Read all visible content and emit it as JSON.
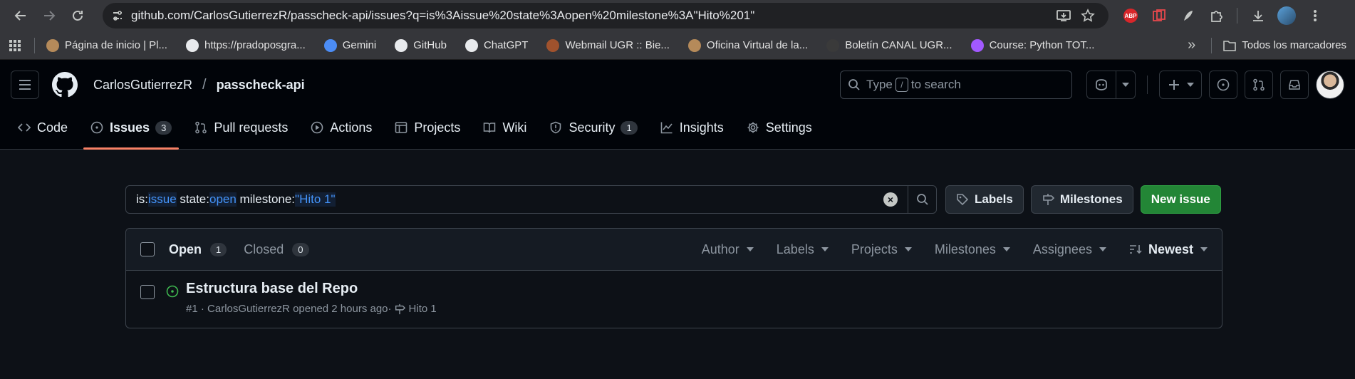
{
  "browser": {
    "url": "github.com/CarlosGutierrezR/passcheck-api/issues?q=is%3Aissue%20state%3Aopen%20milestone%3A\"Hito%201\"",
    "abp_label": "ABP"
  },
  "bookmarks": {
    "items": [
      {
        "label": "Página de inicio | Pl...",
        "color": "#b58a5a"
      },
      {
        "label": "https://pradoposgra...",
        "color": "#e8eaed"
      },
      {
        "label": "Gemini",
        "color": "#4c8df6"
      },
      {
        "label": "GitHub",
        "color": "#e8eaed"
      },
      {
        "label": "ChatGPT",
        "color": "#e8eaed"
      },
      {
        "label": "Webmail UGR :: Bie...",
        "color": "#a0522d"
      },
      {
        "label": "Oficina Virtual de la...",
        "color": "#b58a5a"
      },
      {
        "label": "Boletín CANAL UGR...",
        "color": "#3a3a3a"
      },
      {
        "label": "Course: Python TOT...",
        "color": "#a259ff"
      }
    ],
    "more": "»",
    "all_bookmarks": "Todos los marcadores"
  },
  "repo": {
    "owner": "CarlosGutierrezR",
    "separator": "/",
    "name": "passcheck-api"
  },
  "header": {
    "search_prefix": "Type",
    "search_key": "/",
    "search_suffix": "to search"
  },
  "tabs": [
    {
      "label": "Code",
      "icon": "code-icon"
    },
    {
      "label": "Issues",
      "icon": "issue-opened-icon",
      "count": "3"
    },
    {
      "label": "Pull requests",
      "icon": "git-pull-request-icon"
    },
    {
      "label": "Actions",
      "icon": "play-icon"
    },
    {
      "label": "Projects",
      "icon": "table-icon"
    },
    {
      "label": "Wiki",
      "icon": "book-icon"
    },
    {
      "label": "Security",
      "icon": "shield-icon",
      "count": "1"
    },
    {
      "label": "Insights",
      "icon": "graph-icon"
    },
    {
      "label": "Settings",
      "icon": "gear-icon"
    }
  ],
  "filter": {
    "tokens": [
      {
        "key": "is:",
        "value": "issue"
      },
      {
        "key": " state:",
        "value": "open"
      },
      {
        "key": " milestone:",
        "value": "\"Hito 1\""
      }
    ]
  },
  "buttons": {
    "labels": "Labels",
    "milestones": "Milestones",
    "new_issue": "New issue"
  },
  "list_header": {
    "open_label": "Open",
    "open_count": "1",
    "closed_label": "Closed",
    "closed_count": "0",
    "filters": [
      "Author",
      "Labels",
      "Projects",
      "Milestones",
      "Assignees"
    ],
    "sort": "Newest"
  },
  "issues": [
    {
      "title": "Estructura base del Repo",
      "number": "#1",
      "author": "CarlosGutierrezR",
      "opened": "opened 2 hours ago",
      "milestone": "Hito 1"
    }
  ],
  "colors": {
    "accent_underline": "#f78166",
    "open_green": "#3fb950",
    "primary_button": "#238636",
    "link_blue": "#4493f8"
  }
}
